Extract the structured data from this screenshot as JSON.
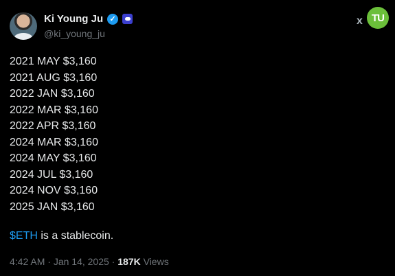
{
  "author": {
    "display_name": "Ki Young Ju",
    "handle": "@ki_young_ju"
  },
  "watermark": {
    "x_label": "x",
    "badge_label": "TU"
  },
  "tweet": {
    "lines": [
      "2021 MAY $3,160",
      "2021 AUG $3,160",
      "2022 JAN $3,160",
      "2022 MAR $3,160",
      "2022 APR $3,160",
      "2024 MAR $3,160",
      "2024 MAY $3,160",
      "2024 JUL $3,160",
      "2024 NOV $3,160",
      "2025 JAN $3,160"
    ],
    "cashtag": "$ETH",
    "closing_text": " is a stablecoin."
  },
  "meta": {
    "time": "4:42 AM",
    "separator": " · ",
    "date": "Jan 14, 2025",
    "separator2": " · ",
    "views_count": "187K",
    "views_label": " Views"
  },
  "colors": {
    "background": "#000000",
    "text": "#e7e9ea",
    "secondary": "#71767b",
    "accent": "#1d9bf0",
    "watermark_badge": "#6bbf3a"
  },
  "icons": {
    "verified": "verified-badge-icon",
    "affiliation": "affiliation-badge-icon"
  }
}
